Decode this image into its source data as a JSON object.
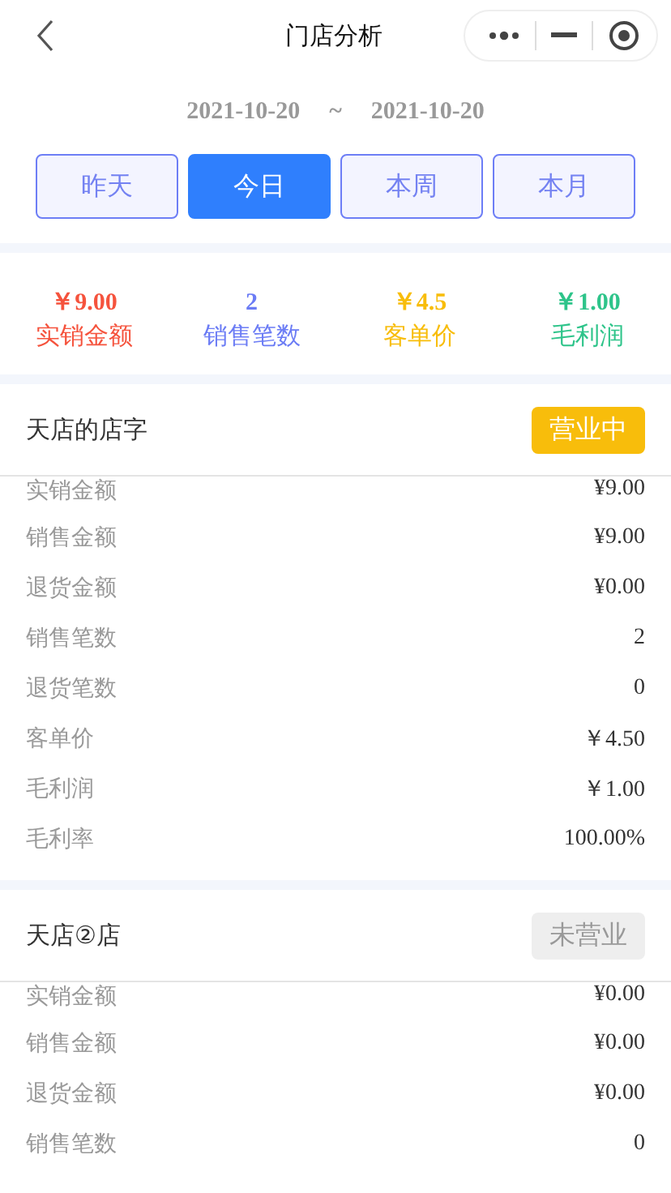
{
  "nav": {
    "title": "门店分析"
  },
  "date_range": {
    "start": "2021-10-20",
    "separator": "~",
    "end": "2021-10-20"
  },
  "periods": [
    {
      "label": "昨天",
      "selected": false
    },
    {
      "label": "今日",
      "selected": true
    },
    {
      "label": "本周",
      "selected": false
    },
    {
      "label": "本月",
      "selected": false
    }
  ],
  "summary": [
    {
      "value": "￥9.00",
      "label": "实销金额",
      "color": "#f5533d"
    },
    {
      "value": "2",
      "label": "销售笔数",
      "color": "#6b7cf5"
    },
    {
      "value": "￥4.5",
      "label": "客单价",
      "color": "#f8bd0b"
    },
    {
      "value": "￥1.00",
      "label": "毛利润",
      "color": "#2ec48a"
    }
  ],
  "stores": [
    {
      "name": "天店的店字",
      "status": "营业中",
      "open": true,
      "rows": [
        {
          "label": "实销金额",
          "value": "¥9.00"
        },
        {
          "label": "销售金额",
          "value": "¥9.00"
        },
        {
          "label": "退货金额",
          "value": "¥0.00"
        },
        {
          "label": "销售笔数",
          "value": "2"
        },
        {
          "label": "退货笔数",
          "value": "0"
        },
        {
          "label": "客单价",
          "value": "￥4.50"
        },
        {
          "label": "毛利润",
          "value": "￥1.00"
        },
        {
          "label": "毛利率",
          "value": "100.00%"
        }
      ]
    },
    {
      "name": "天店②店",
      "status": "未营业",
      "open": false,
      "rows": [
        {
          "label": "实销金额",
          "value": "¥0.00"
        },
        {
          "label": "销售金额",
          "value": "¥0.00"
        },
        {
          "label": "退货金额",
          "value": "¥0.00"
        },
        {
          "label": "销售笔数",
          "value": "0"
        }
      ]
    }
  ]
}
